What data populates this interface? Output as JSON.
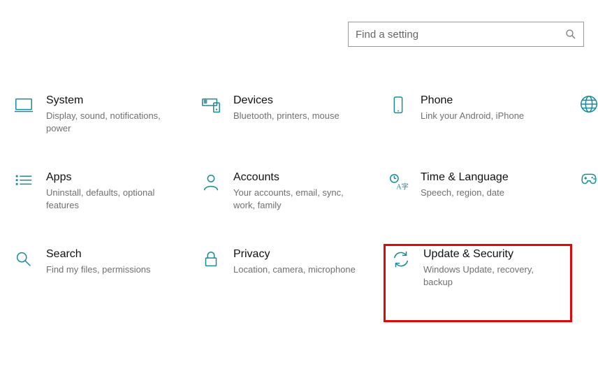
{
  "search": {
    "placeholder": "Find a setting"
  },
  "tiles": {
    "system": {
      "title": "System",
      "desc": "Display, sound, notifications, power"
    },
    "devices": {
      "title": "Devices",
      "desc": "Bluetooth, printers, mouse"
    },
    "phone": {
      "title": "Phone",
      "desc": "Link your Android, iPhone"
    },
    "apps": {
      "title": "Apps",
      "desc": "Uninstall, defaults, optional features"
    },
    "accounts": {
      "title": "Accounts",
      "desc": "Your accounts, email, sync, work, family"
    },
    "time": {
      "title": "Time & Language",
      "desc": "Speech, region, date"
    },
    "search": {
      "title": "Search",
      "desc": "Find my files, permissions"
    },
    "privacy": {
      "title": "Privacy",
      "desc": "Location, camera, microphone"
    },
    "update": {
      "title": "Update & Security",
      "desc": "Windows Update, recovery, backup"
    }
  },
  "colors": {
    "accent": "#188a9a",
    "highlight": "#de0a0a"
  }
}
